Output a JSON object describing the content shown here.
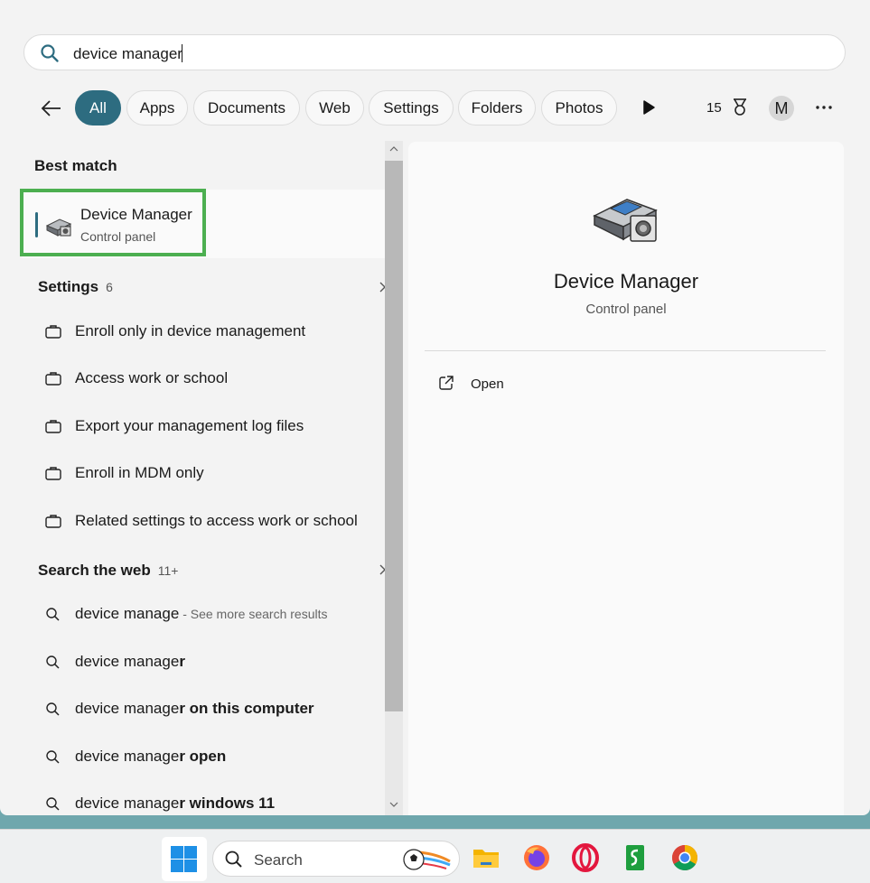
{
  "search": {
    "query": "device manager"
  },
  "filters": {
    "chips": [
      "All",
      "Apps",
      "Documents",
      "Web",
      "Settings",
      "Folders",
      "Photos"
    ],
    "points": "15",
    "avatar_letter": "M"
  },
  "best_match": {
    "heading": "Best match",
    "title": "Device Manager",
    "subtitle": "Control panel"
  },
  "settings_section": {
    "heading": "Settings",
    "count": "6",
    "items": [
      "Enroll only in device management",
      "Access work or school",
      "Export your management log files",
      "Enroll in MDM only",
      "Related settings to access work or school"
    ]
  },
  "web_section": {
    "heading": "Search the web",
    "count": "11+",
    "items": [
      {
        "prefix": "device manage",
        "bold": "",
        "hint": " - See more search results"
      },
      {
        "prefix": "device manage",
        "bold": "r",
        "hint": ""
      },
      {
        "prefix": "device manage",
        "bold": "r on this computer",
        "hint": ""
      },
      {
        "prefix": "device manage",
        "bold": "r open",
        "hint": ""
      },
      {
        "prefix": "device manage",
        "bold": "r windows 11",
        "hint": ""
      }
    ]
  },
  "detail": {
    "title": "Device Manager",
    "subtitle": "Control panel",
    "open_label": "Open"
  },
  "taskbar": {
    "search_label": "Search"
  },
  "colors": {
    "accent": "#2d6c80",
    "highlight": "#4caf50"
  }
}
